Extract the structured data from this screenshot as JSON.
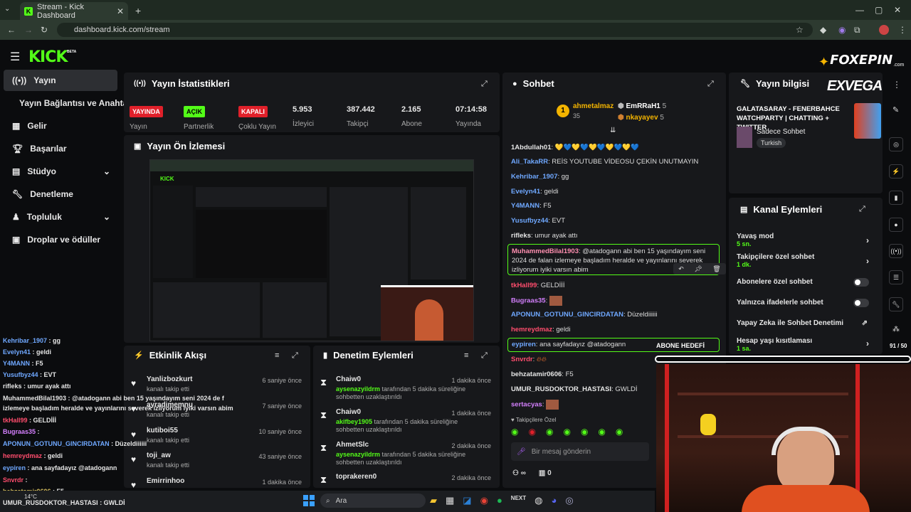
{
  "browser": {
    "tab_title": "Stream - Kick Dashboard",
    "url": "dashboard.kick.com/stream"
  },
  "brand": {
    "logo": "KICK",
    "beta": "BETA",
    "watermark": "FOXEPIN",
    "watermark_sub": ".com"
  },
  "sidebar": {
    "items": [
      {
        "label": "Yayın"
      },
      {
        "label": "Yayın Bağlantısı ve Anahtarı"
      },
      {
        "label": "Gelir"
      },
      {
        "label": "Başarılar"
      },
      {
        "label": "Stüdyo"
      },
      {
        "label": "Denetleme"
      },
      {
        "label": "Topluluk"
      },
      {
        "label": "Droplar ve ödüller"
      }
    ]
  },
  "stats": {
    "title": "Yayın İstatistikleri",
    "items": [
      {
        "value": "YAYINDA",
        "label": "Yayın"
      },
      {
        "value": "AÇIK",
        "label": "Partnerlik"
      },
      {
        "value": "KAPALI",
        "label": "Çoklu Yayın"
      },
      {
        "value": "5.953",
        "label": "İzleyici"
      },
      {
        "value": "387.442",
        "label": "Takipçi"
      },
      {
        "value": "2.165",
        "label": "Abone"
      },
      {
        "value": "07:14:58",
        "label": "Yayında"
      }
    ]
  },
  "preview": {
    "title": "Yayın Ön İzlemesi"
  },
  "activity": {
    "title": "Etkinlik Akışı",
    "items": [
      {
        "name": "Yanlizbozkurt",
        "sub": "kanalı takip etti",
        "time": "6 saniye önce"
      },
      {
        "name": "ayradimemnu",
        "sub": "kanalı takip etti",
        "time": "7 saniye önce"
      },
      {
        "name": "kutiboi55",
        "sub": "kanalı takip etti",
        "time": "10 saniye önce"
      },
      {
        "name": "toji_aw",
        "sub": "kanalı takip etti",
        "time": "43 saniye önce"
      },
      {
        "name": "Emirrinhoo",
        "sub": "",
        "time": "1 dakika önce"
      }
    ]
  },
  "modlog": {
    "title": "Denetim Eylemleri",
    "items": [
      {
        "name": "Chaiw0",
        "mod": "aysenazyildrm",
        "text": " tarafından 5 dakika süreliğine sohbetten uzaklaştırıldı",
        "time": "1 dakika önce"
      },
      {
        "name": "Chaiw0",
        "mod": "akifbey1905",
        "text": " tarafından 5 dakika süreliğine sohbetten uzaklaştırıldı",
        "time": "1 dakika önce"
      },
      {
        "name": "AhmetSlc",
        "mod": "aysenazyildrm",
        "text": " tarafından 5 dakika süreliğine sohbetten uzaklaştırıldı",
        "time": "2 dakika önce"
      },
      {
        "name": "toprakeren0",
        "mod": "",
        "text": "",
        "time": "2 dakika önce"
      }
    ]
  },
  "chat": {
    "title": "Sohbet",
    "top": [
      {
        "name": "ahmetalmaz",
        "count": "35"
      },
      {
        "name": "EmRRaH1",
        "count": "5"
      },
      {
        "name": "nkayayev",
        "count": "5"
      }
    ],
    "messages": [
      {
        "user": "1Abdullah01",
        "color": "#e6e6e6",
        "text": " 💛💙💛💙💛💙💛💙💛💙"
      },
      {
        "user": "Ali_TakaRR",
        "color": "#6fa8ff",
        "text": " REİS YOUTUBE VİDEOSU ÇEKİN UNUTMAYIN"
      },
      {
        "user": "Kehribar_1907",
        "color": "#6fa8ff",
        "text": " gg"
      },
      {
        "user": "Evelyn41",
        "color": "#6fa8ff",
        "text": " geldi"
      },
      {
        "user": "Y4MANN",
        "color": "#6fa8ff",
        "text": " F5"
      },
      {
        "user": "Yusufbyz44",
        "color": "#6fa8ff",
        "text": " EVT"
      },
      {
        "user": "rifleks",
        "color": "#e6e6e6",
        "text": " umur ayak attı"
      },
      {
        "user": "tkHall99",
        "color": "#ff4d6d",
        "text": " GELDİİİ"
      },
      {
        "user": "Bugraas35",
        "color": "#d580ff",
        "text": ""
      },
      {
        "user": "APONUN_GOTUNU_GINCIRDATAN",
        "color": "#6fa8ff",
        "text": " Düzeldiiiiii"
      },
      {
        "user": "hemreydmaz",
        "color": "#ff4d6d",
        "text": " geldi"
      },
      {
        "user": "Snvrdr",
        "color": "#ff4d6d",
        "text": ""
      },
      {
        "user": "behzatamir0606",
        "color": "#e6e6e6",
        "text": " F5"
      },
      {
        "user": "UMUR_RUSDOKTOR_HASTASI",
        "color": "#e6e6e6",
        "text": " GWLDİ"
      },
      {
        "user": "sertacyas",
        "color": "#d580ff",
        "text": ""
      }
    ],
    "highlight1": {
      "user": "MuhammedBilal1903",
      "text": " @atadogann abi ben 15 yaşındayım seni 2024 de falan izlemeye başladım heralde ve yayınlarını severek izliyorum iyiki varsın abim"
    },
    "highlight2": {
      "user": "eypiren",
      "text": " ana sayfadayız @atadogann"
    },
    "goal": "ABONE HEDEFİ",
    "follower_label": "Takipçilere Özel",
    "input_placeholder": "Bir mesaj gönderin",
    "footer_inf": "∞",
    "footer_count": "0"
  },
  "info": {
    "title": "Yayın bilgisi",
    "stream_title": "GALATASARAY - FENERBAHCE WATCHPARTY | CHATTING + TWITTER",
    "category": "Sadece Sohbet",
    "language": "Turkish",
    "sponsor": "EXVEGA"
  },
  "actions": {
    "title": "Kanal Eylemleri",
    "items": [
      {
        "label": "Yavaş mod",
        "sub": "5 sn."
      },
      {
        "label": "Takipçilere özel sohbet",
        "sub": "1 dk."
      },
      {
        "label": "Abonelere özel sohbet",
        "sub": ""
      },
      {
        "label": "Yalnızca ifadelerle sohbet",
        "sub": ""
      },
      {
        "label": "Yapay Zeka ile Sohbet Denetimi",
        "sub": ""
      },
      {
        "label": "Hesap yaşı kısıtlaması",
        "sub": "1 sa."
      }
    ]
  },
  "overlay_chat": [
    {
      "user": "Kehribar_1907",
      "color": "#6fa8ff",
      "text": " : gg"
    },
    {
      "user": "Evelyn41",
      "color": "#6fa8ff",
      "text": " : geldi"
    },
    {
      "user": "Y4MANN",
      "color": "#6fa8ff",
      "text": " : F5"
    },
    {
      "user": "Yusufbyz44",
      "color": "#6fa8ff",
      "text": " : EVT"
    },
    {
      "user": "rifleks",
      "color": "#e6e6e6",
      "text": " : umur ayak attı"
    },
    {
      "user": "MuhammedBilal1903",
      "color": "#e6e6e6",
      "text": " : @atadogann abi ben 15 yaşındayım seni 2024 de f"
    },
    {
      "user": "",
      "color": "#e6e6e6",
      "text": "izlemeye başladım heralde ve yayınlarını severek izliyorum iyiki varsın abim"
    },
    {
      "user": "tkHall99",
      "color": "#ff4d6d",
      "text": " : GELDİİİ"
    },
    {
      "user": "Bugraas35",
      "color": "#d580ff",
      "text": " :"
    },
    {
      "user": "APONUN_GOTUNU_GINCIRDATAN",
      "color": "#6fa8ff",
      "text": " : Düzeldiiiiii"
    },
    {
      "user": "hemreydmaz",
      "color": "#ff4d6d",
      "text": " : geldi"
    },
    {
      "user": "eypiren",
      "color": "#6fa8ff",
      "text": " : ana sayfadayız @atadogann"
    },
    {
      "user": "Snvrdr",
      "color": "#ff4d6d",
      "text": " :"
    },
    {
      "user": "behzatamir0606",
      "color": "#d8c060",
      "text": " : F5"
    },
    {
      "user": "UMUR_RUSDOKTOR_HASTASI",
      "color": "#e6e6e6",
      "text": " : GWLDİ"
    }
  ],
  "goal_counter": "91 / 50",
  "taskbar": {
    "search": "Ara",
    "weather": "14°C"
  }
}
